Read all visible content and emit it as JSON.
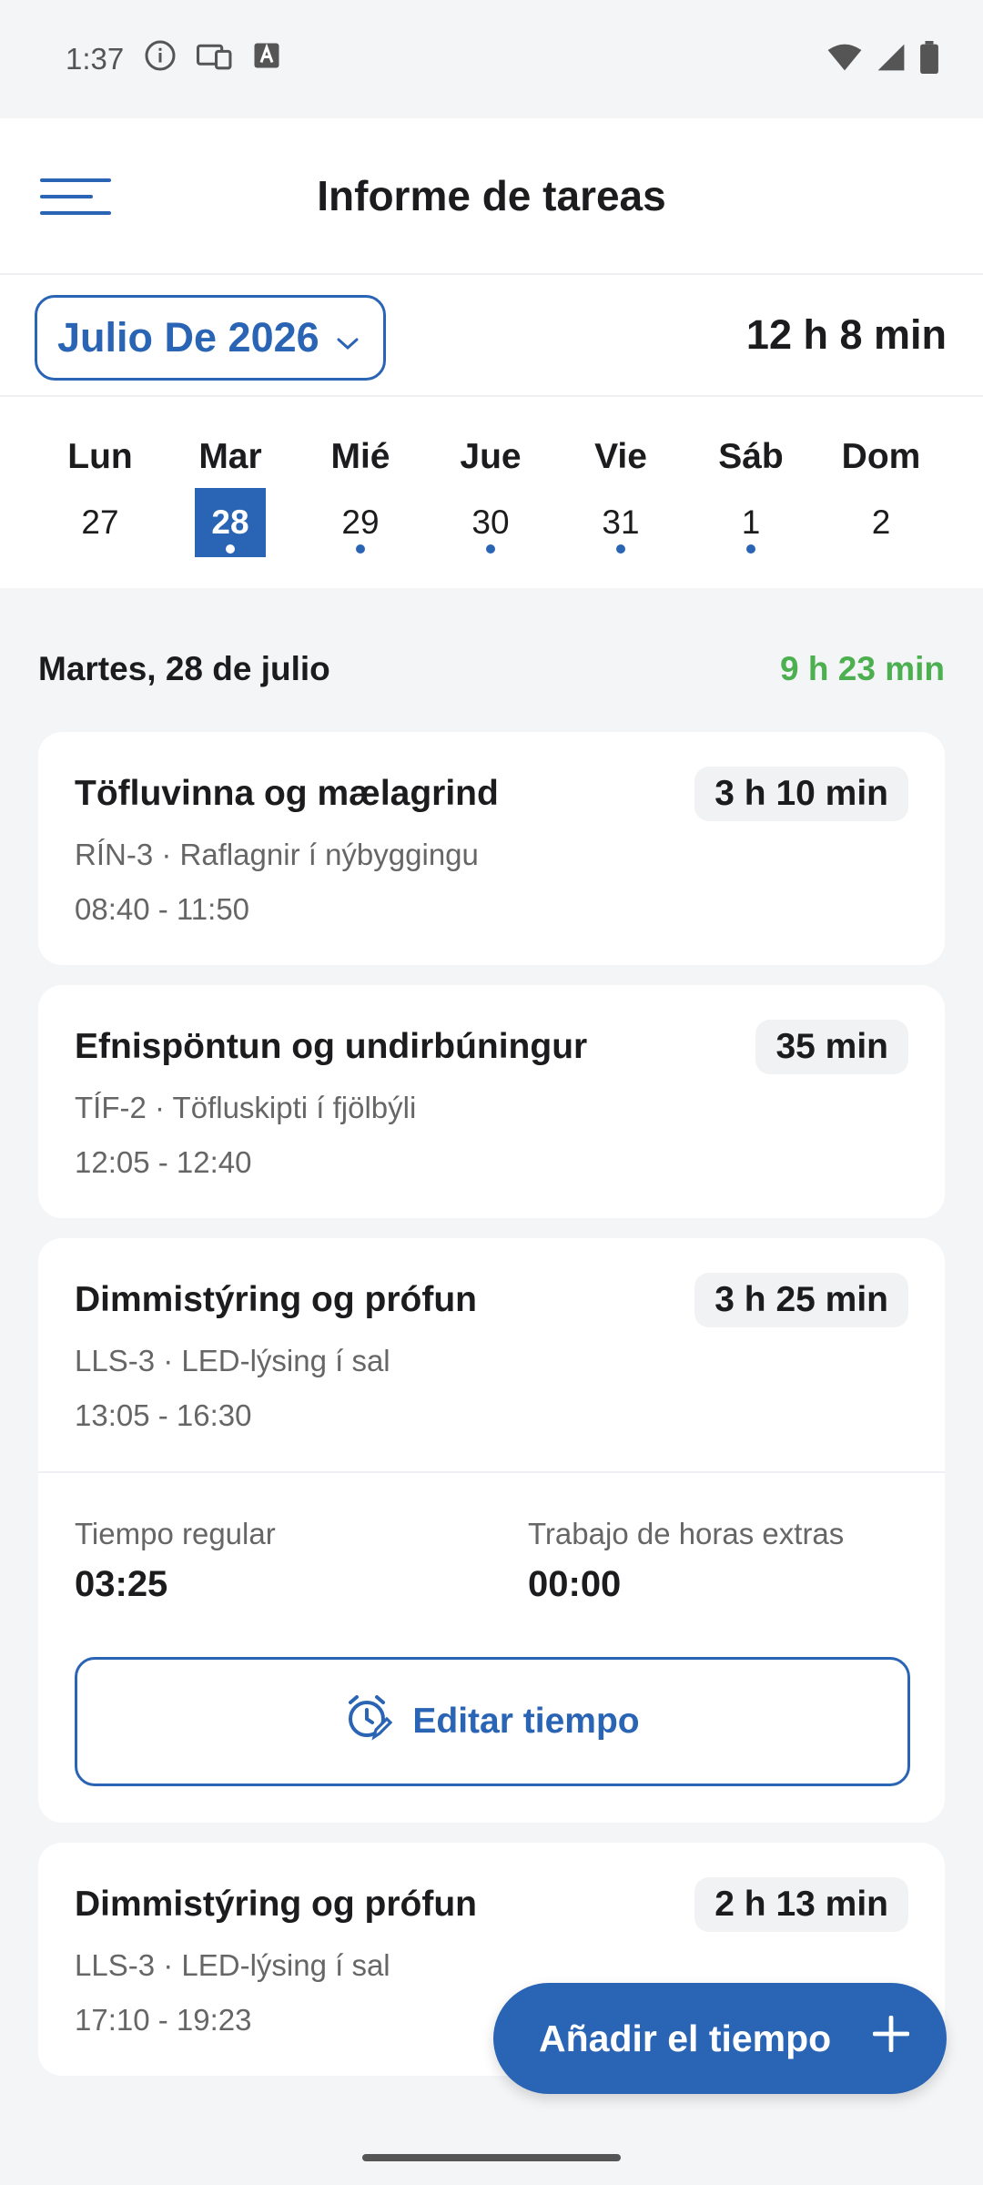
{
  "status_bar": {
    "time": "1:37"
  },
  "app_bar": {
    "title": "Informe de tareas"
  },
  "month_bar": {
    "month_label": "Julio De 2026",
    "total": "12 h 8 min"
  },
  "week": [
    {
      "name": "Lun",
      "num": "27",
      "selected": false,
      "dot": false
    },
    {
      "name": "Mar",
      "num": "28",
      "selected": true,
      "dot": true
    },
    {
      "name": "Mié",
      "num": "29",
      "selected": false,
      "dot": true
    },
    {
      "name": "Jue",
      "num": "30",
      "selected": false,
      "dot": true
    },
    {
      "name": "Vie",
      "num": "31",
      "selected": false,
      "dot": true
    },
    {
      "name": "Sáb",
      "num": "1",
      "selected": false,
      "dot": true
    },
    {
      "name": "Dom",
      "num": "2",
      "selected": false,
      "dot": false
    }
  ],
  "day_summary": {
    "date": "Martes, 28 de julio",
    "total": "9 h 23 min"
  },
  "tasks": [
    {
      "title": "Töfluvinna og mælagrind",
      "duration": "3 h 10 min",
      "project": "RÍN-3 · Raflagnir í nýbyggingu",
      "time": "08:40 - 11:50"
    },
    {
      "title": "Efnispöntun og undirbúningur",
      "duration": "35 min",
      "project": "TÍF-2 · Töfluskipti í fjölbýli",
      "time": "12:05 - 12:40"
    },
    {
      "title": "Dimmistýring og prófun",
      "duration": "3 h 25 min",
      "project": "LLS-3 · LED-lýsing í sal",
      "time": "13:05 - 16:30",
      "regular_label": "Tiempo regular",
      "regular_value": "03:25",
      "overtime_label": "Trabajo de horas extras",
      "overtime_value": "00:00",
      "edit_label": "Editar tiempo"
    },
    {
      "title": "Dimmistýring og prófun",
      "duration": "2 h 13 min",
      "project": "LLS-3 · LED-lýsing í sal",
      "time": "17:10 - 19:23"
    }
  ],
  "fab": {
    "label": "Añadir el tiempo"
  },
  "colors": {
    "accent": "#2a64b4",
    "positive": "#4caf50",
    "background": "#f4f5f7"
  }
}
